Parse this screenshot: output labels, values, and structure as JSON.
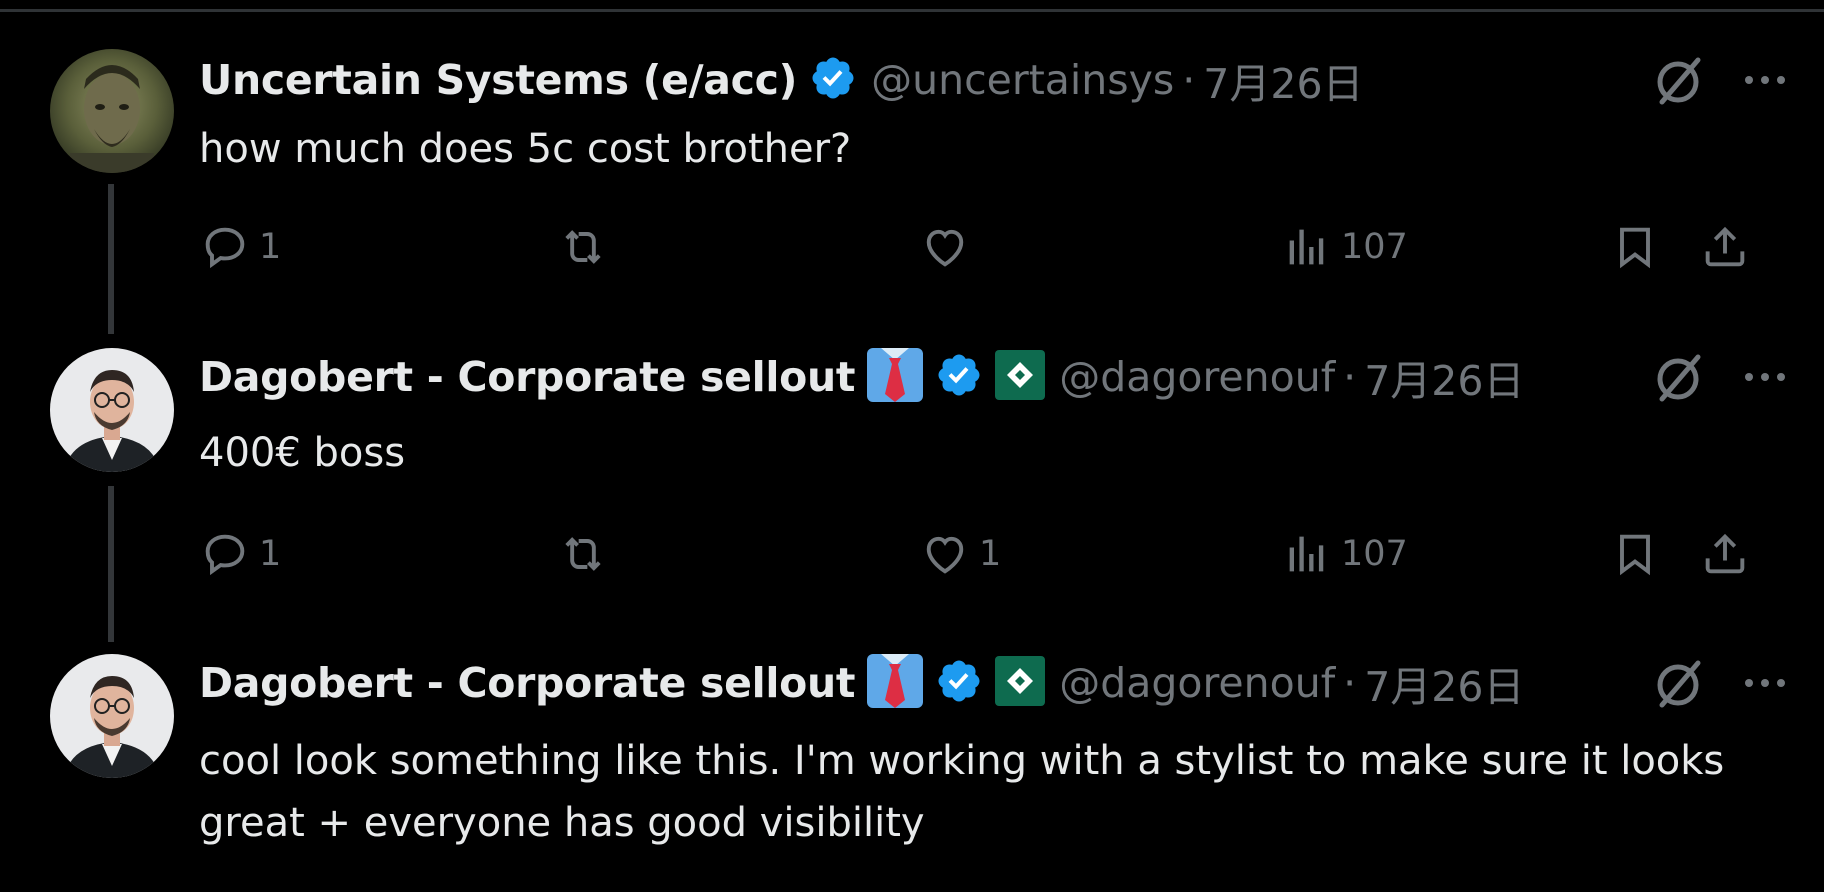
{
  "tweets": [
    {
      "name": "Uncertain Systems (e/acc)",
      "handle": "@uncertainsys",
      "separator": "·",
      "date": "7月26日",
      "text": "how much does 5c cost brother?",
      "replies": "1",
      "reposts": "",
      "likes": "",
      "views": "107",
      "verified": true,
      "has_tie_emoji": false,
      "has_affiliate_badge": false
    },
    {
      "name": "Dagobert - Corporate sellout",
      "handle": "@dagorenouf",
      "separator": "·",
      "date": "7月26日",
      "text": "400€ boss",
      "replies": "1",
      "reposts": "",
      "likes": "1",
      "views": "107",
      "verified": true,
      "has_tie_emoji": true,
      "has_affiliate_badge": true
    },
    {
      "name": "Dagobert - Corporate sellout",
      "handle": "@dagorenouf",
      "separator": "·",
      "date": "7月26日",
      "text": "cool look something like this. I'm working with a stylist to make sure it looks great + everyone has good visibility",
      "verified": true,
      "has_tie_emoji": true,
      "has_affiliate_badge": true
    }
  ],
  "colors": {
    "background": "#000000",
    "text_primary": "#e7e9ea",
    "text_secondary": "#71767b",
    "verified_blue": "#1d9bf0",
    "thread_line": "#333639"
  },
  "icons": {
    "reply": "reply-icon",
    "repost": "repost-icon",
    "like": "heart-icon",
    "views": "views-icon",
    "bookmark": "bookmark-icon",
    "share": "share-icon",
    "grok": "grok-icon",
    "more": "more-icon",
    "verified": "verified-badge-icon"
  }
}
